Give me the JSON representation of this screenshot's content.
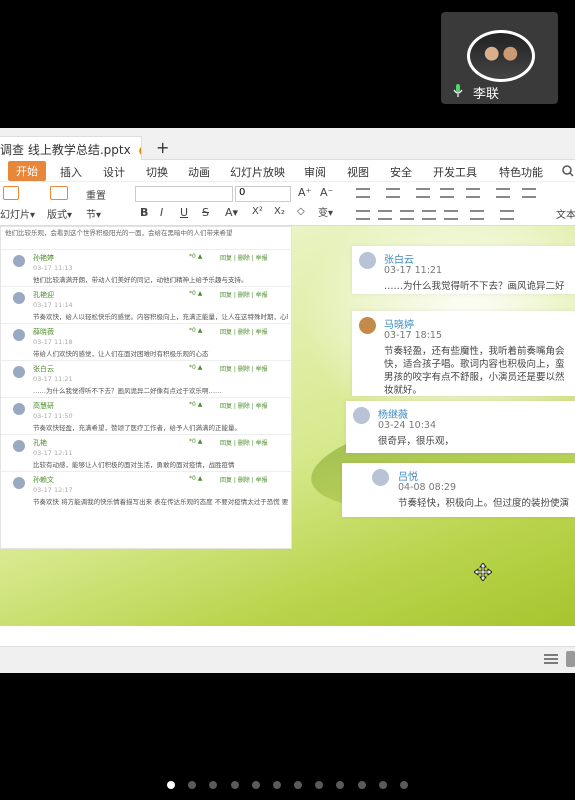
{
  "meeting": {
    "participant_name": "李联"
  },
  "app": {
    "doc_tab_title": "调查 线上教学总结.pptx",
    "doc_tab_modified_dot": "●",
    "new_tab_label": "+",
    "menu": [
      "开始",
      "插入",
      "设计",
      "切换",
      "动画",
      "幻灯片放映",
      "审阅",
      "视图",
      "安全",
      "开发工具",
      "特色功能"
    ],
    "toolbar": {
      "new_slide": "幻灯片▾",
      "layout": "版式▾",
      "reset": "重置",
      "section": "节▾",
      "font_size": "0",
      "text_label": "文本"
    }
  },
  "slide": {
    "left_panel": {
      "top_text": "他们比较乐观，会看到这个世界积极阳光的一面，会给在黑暗中的人们带来希望",
      "items": [
        {
          "name": "孙艳婷",
          "date": "03-17 11:13",
          "stats": "*0 ▲",
          "actions": "回复 | 删除 | 举报",
          "text": "他们比较满满开朗，带动人们美好的同记，动他们精神上给予乐趣与支持。"
        },
        {
          "name": "孔艳迎",
          "date": "03-17 11:14",
          "stats": "*0 ▲",
          "actions": "回复 | 删除 | 举报",
          "text": "节奏欢快，给人以轻松快乐的感觉。内容积极向上，充满正能量，让人在这特殊时期，心理也是阳光开朗的，给人以心灵的慰藉。"
        },
        {
          "name": "薛晓薇",
          "date": "03-17 11:18",
          "stats": "*0 ▲",
          "actions": "回复 | 删除 | 举报",
          "text": "带给人们欢快的感觉，让人们在面对困难时有积极乐观的心态"
        },
        {
          "name": "张白云",
          "date": "03-17 11:21",
          "stats": "*0 ▲",
          "actions": "回复 | 删除 | 举报",
          "text": "……为什么我觉得听不下去？画风诡异二好像有点过于欢乐啊……"
        },
        {
          "name": "高慧研",
          "date": "03-17 11:50",
          "stats": "*0 ▲",
          "actions": "回复 | 删除 | 举报",
          "text": "节奏欢快轻盈，充满希望，赞颂了医疗工作者，给予人们满满的正能量。"
        },
        {
          "name": "孔艳",
          "date": "03-17 12:11",
          "stats": "*0 ▲",
          "actions": "回复 | 删除 | 举报",
          "text": "比较有动感，能够让人们积极的面对生活，勇敢的面对疫情，战胜疫情"
        },
        {
          "name": "孙赖文",
          "date": "03-17 12:17",
          "stats": "*0 ▲",
          "actions": "回复 | 删除 | 举报",
          "text": "节奏欢快 将方能调我的快乐情着描写出来 表在传达乐观的态度 不要对疫情太过于恐慌 要充满希望和正能量。"
        }
      ]
    },
    "comments": [
      {
        "name": "张白云",
        "date": "03-17 11:21",
        "text": "……为什么我觉得听不下去？画风诡异二好"
      },
      {
        "name": "马晓婷",
        "date": "03-17 18:15",
        "text": "节奏轻盈，还有些魔性，我听着前奏嘴角会\n快，适合孩子唱。歌词内容也积极向上，蛮\n男孩的咬字有点不舒服，小演员还是要以然\n妆就好。"
      },
      {
        "name": "杨继薇",
        "date": "03-24 10:34",
        "text": "很奇异，很乐观，"
      },
      {
        "name": "吕悦",
        "date": "04-08 08:29",
        "text": "节奏轻快，积极向上。但过度的装扮使演"
      }
    ]
  },
  "pager": {
    "count": 12,
    "active_index": 0
  }
}
